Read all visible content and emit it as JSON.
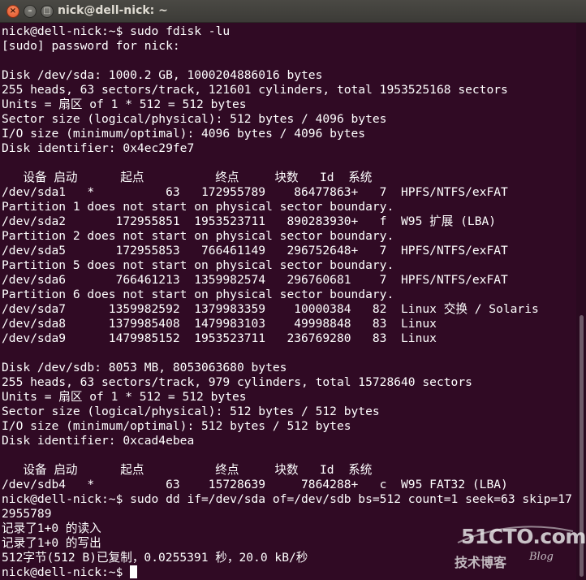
{
  "window": {
    "title": "nick@dell-nick: ~",
    "close_glyph": "×",
    "min_glyph": "–",
    "max_glyph": "□"
  },
  "terminal": {
    "lines": [
      "nick@dell-nick:~$ sudo fdisk -lu",
      "[sudo] password for nick:",
      "",
      "Disk /dev/sda: 1000.2 GB, 1000204886016 bytes",
      "255 heads, 63 sectors/track, 121601 cylinders, total 1953525168 sectors",
      "Units = 扇区 of 1 * 512 = 512 bytes",
      "Sector size (logical/physical): 512 bytes / 4096 bytes",
      "I/O size (minimum/optimal): 4096 bytes / 4096 bytes",
      "Disk identifier: 0x4ec29fe7",
      "",
      "   设备 启动      起点          终点     块数   Id  系统",
      "/dev/sda1   *          63   172955789    86477863+   7  HPFS/NTFS/exFAT",
      "Partition 1 does not start on physical sector boundary.",
      "/dev/sda2       172955851  1953523711   890283930+   f  W95 扩展 (LBA)",
      "Partition 2 does not start on physical sector boundary.",
      "/dev/sda5       172955853   766461149   296752648+   7  HPFS/NTFS/exFAT",
      "Partition 5 does not start on physical sector boundary.",
      "/dev/sda6       766461213  1359982574   296760681    7  HPFS/NTFS/exFAT",
      "Partition 6 does not start on physical sector boundary.",
      "/dev/sda7      1359982592  1379983359    10000384   82  Linux 交换 / Solaris",
      "/dev/sda8      1379985408  1479983103    49998848   83  Linux",
      "/dev/sda9      1479985152  1953523711   236769280   83  Linux",
      "",
      "Disk /dev/sdb: 8053 MB, 8053063680 bytes",
      "255 heads, 63 sectors/track, 979 cylinders, total 15728640 sectors",
      "Units = 扇区 of 1 * 512 = 512 bytes",
      "Sector size (logical/physical): 512 bytes / 512 bytes",
      "I/O size (minimum/optimal): 512 bytes / 512 bytes",
      "Disk identifier: 0xcad4ebea",
      "",
      "   设备 启动      起点          终点     块数   Id  系统",
      "/dev/sdb4   *          63    15728639     7864288+   c  W95 FAT32 (LBA)",
      "nick@dell-nick:~$ sudo dd if=/dev/sda of=/dev/sdb bs=512 count=1 seek=63 skip=17",
      "2955789",
      "记录了1+0 的读入",
      "记录了1+0 的写出",
      "512字节(512 B)已复制，0.0255391 秒，20.0 kB/秒",
      "nick@dell-nick:~$ "
    ]
  },
  "watermark": {
    "logo": "51CTO.com",
    "sub": "技术博客",
    "blog": "Blog"
  }
}
